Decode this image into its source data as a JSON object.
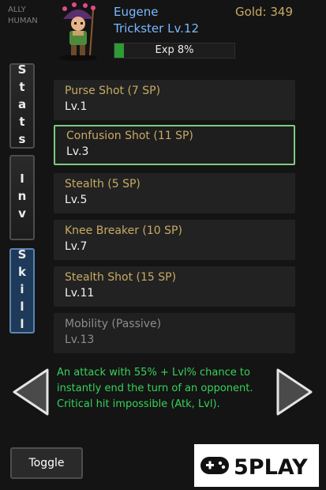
{
  "header": {
    "ally_label": "ALLY",
    "race_label": "HUMAN",
    "character_name": "Eugene",
    "class_level": "Trickster Lv.12",
    "gold": "Gold: 349",
    "exp_text": "Exp 8%",
    "exp_percent": 8
  },
  "tabs": [
    {
      "label": "Stats",
      "active": false
    },
    {
      "label": "Inv",
      "active": false
    },
    {
      "label": "Skill",
      "active": true
    }
  ],
  "skills": [
    {
      "name": "Purse Shot (7 SP)",
      "level": "Lv.1"
    },
    {
      "name": "Confusion Shot (11 SP)",
      "level": "Lv.3"
    },
    {
      "name": "Stealth (5 SP)",
      "level": "Lv.5"
    },
    {
      "name": "Knee Breaker (10 SP)",
      "level": "Lv.7"
    },
    {
      "name": "Stealth Shot (15 SP)",
      "level": "Lv.11"
    },
    {
      "name": "Mobility (Passive)",
      "level": "Lv.13"
    }
  ],
  "description": "An attack with 55% + Lvl% chance to instantly end the turn of an opponent. Critical hit impossible (Atk, Lvl).",
  "toggle_label": "Toggle",
  "watermark": "5PLAY",
  "icons": {
    "prev": "triangle-left-icon",
    "next": "triangle-right-icon",
    "logo": "gamepad-icon"
  },
  "colors": {
    "name_blue": "#79b8ff",
    "gold": "#c8aa64",
    "exp_green": "#2e9b35",
    "selected_border": "#7ecb7e",
    "description_green": "#35d25a"
  }
}
